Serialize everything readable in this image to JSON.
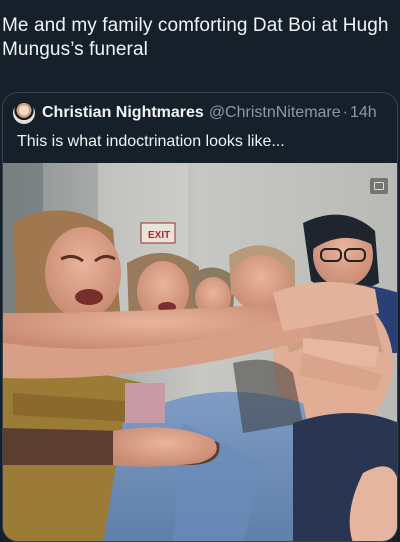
{
  "post": {
    "caption": "Me and my family comforting Dat Boi at Hugh Mungus’s funeral"
  },
  "quoted_post": {
    "display_name": "Christian Nightmares",
    "handle": "@ChristnNitemare",
    "separator": "·",
    "time": "14h",
    "text": "This is what indoctrination looks like..."
  },
  "media": {
    "exit_sign_text": "EXIT",
    "gif_icon": "media-expand-icon"
  },
  "colors": {
    "background": "#15202b",
    "text": "#e7e9ea",
    "secondary_text": "#8b98a5",
    "border": "#38444d"
  }
}
